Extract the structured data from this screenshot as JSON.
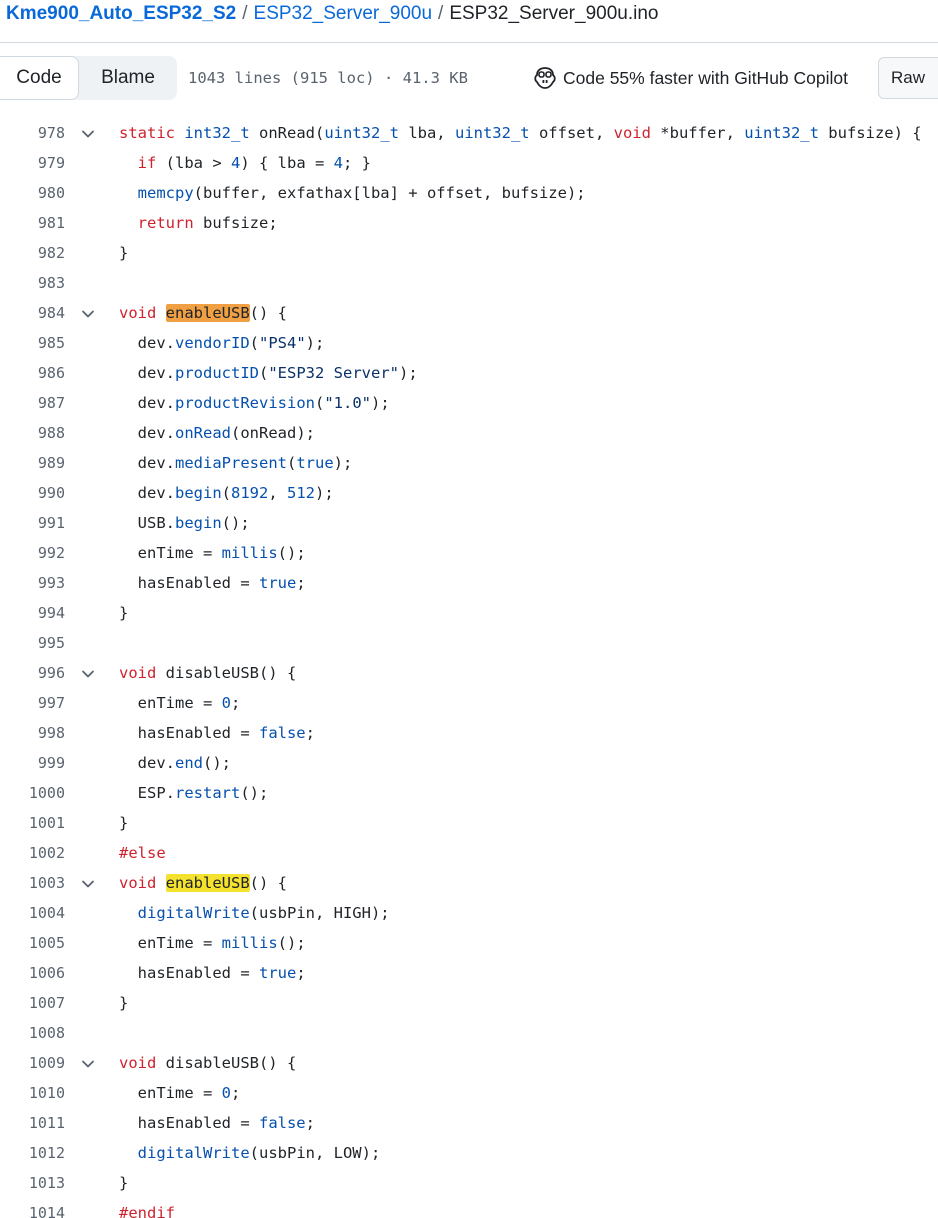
{
  "breadcrumb": {
    "repo": "Kme900_Auto_ESP32_S2",
    "folder": "ESP32_Server_900u",
    "file": "ESP32_Server_900u.ino",
    "separator": "/"
  },
  "toolbar": {
    "code_label": "Code",
    "blame_label": "Blame",
    "file_info": "1043 lines (915 loc) · 41.3 KB",
    "copilot_label": "Code 55% faster with GitHub Copilot",
    "raw_label": "Raw"
  },
  "code_lines": [
    {
      "num": "978",
      "fold": true,
      "html": "<span class=\"kw\">static</span> <span class=\"ty\">int32_t</span> onRead(<span class=\"ty\">uint32_t</span> lba, <span class=\"ty\">uint32_t</span> offset, <span class=\"kw\">void</span> *buffer, <span class=\"ty\">uint32_t</span> bufsize) {"
    },
    {
      "num": "979",
      "fold": false,
      "html": "  <span class=\"kw\">if</span> (lba &gt; <span class=\"num\">4</span>) { lba = <span class=\"num\">4</span>; }"
    },
    {
      "num": "980",
      "fold": false,
      "html": "  <span class=\"fn\">memcpy</span>(buffer, exfathax[lba] + offset, bufsize);"
    },
    {
      "num": "981",
      "fold": false,
      "html": "  <span class=\"kw\">return</span> bufsize;"
    },
    {
      "num": "982",
      "fold": false,
      "html": "}"
    },
    {
      "num": "983",
      "fold": false,
      "html": ""
    },
    {
      "num": "984",
      "fold": true,
      "html": "<span class=\"kw\">void</span> <span class=\"hl-a\">enableUSB</span>() {"
    },
    {
      "num": "985",
      "fold": false,
      "html": "  dev.<span class=\"fn\">vendorID</span>(<span class=\"str\">\"PS4\"</span>);"
    },
    {
      "num": "986",
      "fold": false,
      "html": "  dev.<span class=\"fn\">productID</span>(<span class=\"str\">\"ESP32 Server\"</span>);"
    },
    {
      "num": "987",
      "fold": false,
      "html": "  dev.<span class=\"fn\">productRevision</span>(<span class=\"str\">\"1.0\"</span>);"
    },
    {
      "num": "988",
      "fold": false,
      "html": "  dev.<span class=\"fn\">onRead</span>(onRead);"
    },
    {
      "num": "989",
      "fold": false,
      "html": "  dev.<span class=\"fn\">mediaPresent</span>(<span class=\"num\">true</span>);"
    },
    {
      "num": "990",
      "fold": false,
      "html": "  dev.<span class=\"fn\">begin</span>(<span class=\"num\">8192</span>, <span class=\"num\">512</span>);"
    },
    {
      "num": "991",
      "fold": false,
      "html": "  USB.<span class=\"fn\">begin</span>();"
    },
    {
      "num": "992",
      "fold": false,
      "html": "  enTime = <span class=\"fn\">millis</span>();"
    },
    {
      "num": "993",
      "fold": false,
      "html": "  hasEnabled = <span class=\"num\">true</span>;"
    },
    {
      "num": "994",
      "fold": false,
      "html": "}"
    },
    {
      "num": "995",
      "fold": false,
      "html": ""
    },
    {
      "num": "996",
      "fold": true,
      "html": "<span class=\"kw\">void</span> disableUSB() {"
    },
    {
      "num": "997",
      "fold": false,
      "html": "  enTime = <span class=\"num\">0</span>;"
    },
    {
      "num": "998",
      "fold": false,
      "html": "  hasEnabled = <span class=\"num\">false</span>;"
    },
    {
      "num": "999",
      "fold": false,
      "html": "  dev.<span class=\"fn\">end</span>();"
    },
    {
      "num": "1000",
      "fold": false,
      "html": "  ESP.<span class=\"fn\">restart</span>();"
    },
    {
      "num": "1001",
      "fold": false,
      "html": "}"
    },
    {
      "num": "1002",
      "fold": false,
      "html": "<span class=\"kw\">#else</span>"
    },
    {
      "num": "1003",
      "fold": true,
      "html": "<span class=\"kw\">void</span> <span class=\"hl-y\">enableUSB</span>() {"
    },
    {
      "num": "1004",
      "fold": false,
      "html": "  <span class=\"fn\">digitalWrite</span>(usbPin, HIGH);"
    },
    {
      "num": "1005",
      "fold": false,
      "html": "  enTime = <span class=\"fn\">millis</span>();"
    },
    {
      "num": "1006",
      "fold": false,
      "html": "  hasEnabled = <span class=\"num\">true</span>;"
    },
    {
      "num": "1007",
      "fold": false,
      "html": "}"
    },
    {
      "num": "1008",
      "fold": false,
      "html": ""
    },
    {
      "num": "1009",
      "fold": true,
      "html": "<span class=\"kw\">void</span> disableUSB() {"
    },
    {
      "num": "1010",
      "fold": false,
      "html": "  enTime = <span class=\"num\">0</span>;"
    },
    {
      "num": "1011",
      "fold": false,
      "html": "  hasEnabled = <span class=\"num\">false</span>;"
    },
    {
      "num": "1012",
      "fold": false,
      "html": "  <span class=\"fn\">digitalWrite</span>(usbPin, LOW);"
    },
    {
      "num": "1013",
      "fold": false,
      "html": "}"
    },
    {
      "num": "1014",
      "fold": false,
      "html": "<span class=\"kw\">#endif</span>"
    }
  ]
}
